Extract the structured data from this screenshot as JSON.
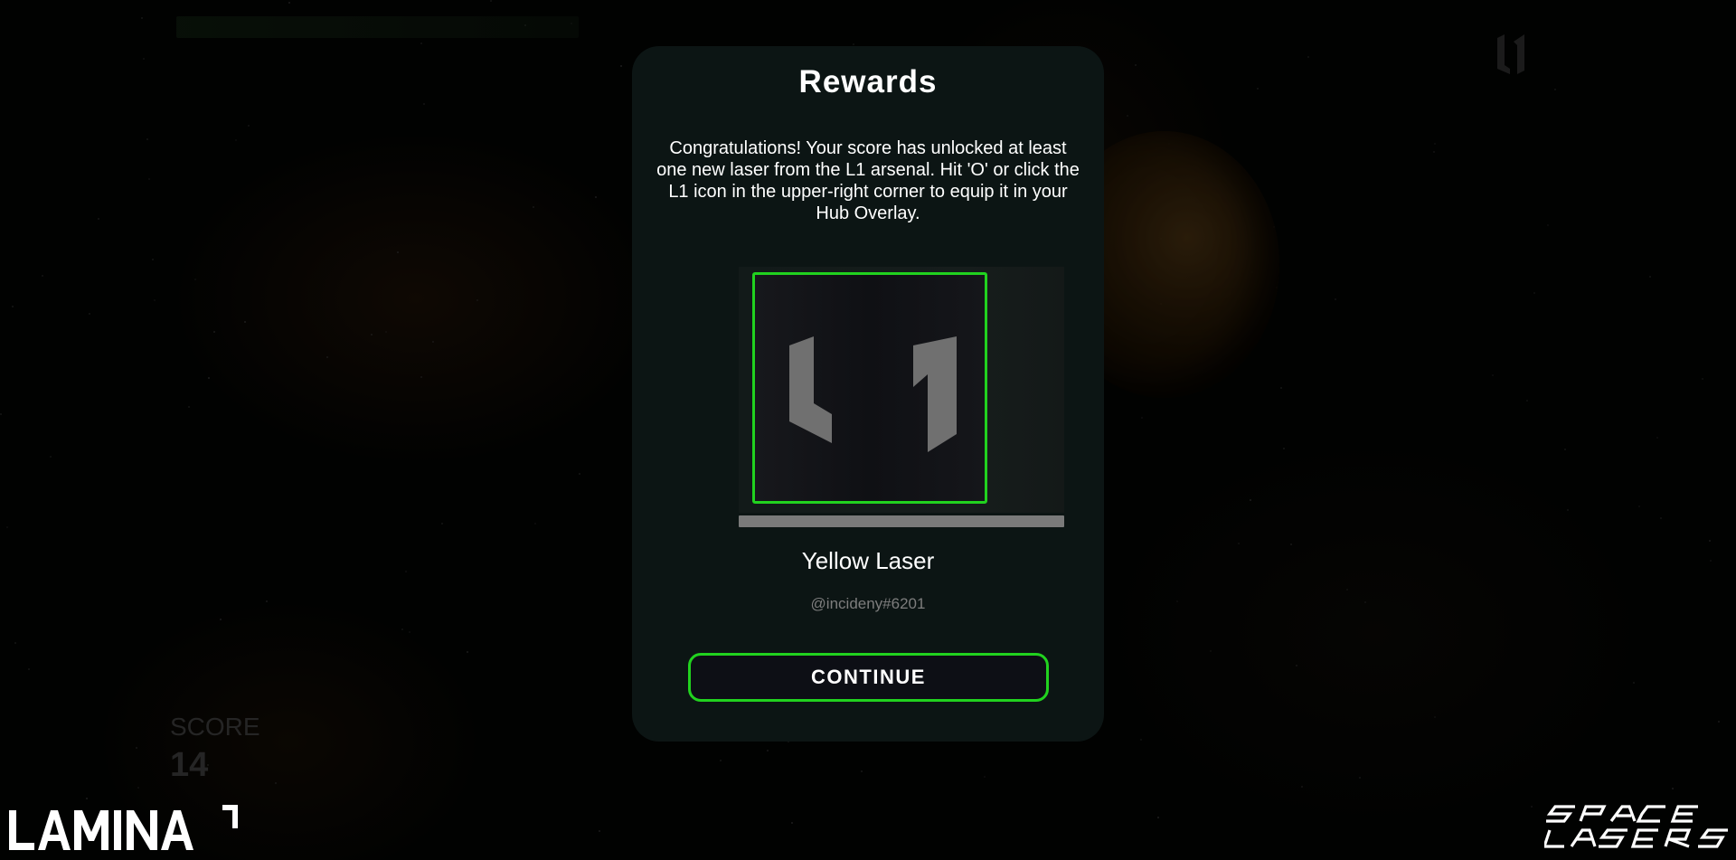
{
  "background": {
    "score_label": "SCORE",
    "score_value": "14",
    "lamina_logo_text": "LAMINA1",
    "space_lasers_logo_text": "SPACE LASERS"
  },
  "modal": {
    "title": "Rewards",
    "message": "Congratulations! Your score has unlocked at least one new laser from the L1 arsenal. Hit 'O' or click the L1 icon in the upper-right corner to equip it in your Hub Overlay.",
    "reward": {
      "icon": "l1-logo-icon",
      "name": "Yellow Laser",
      "author": "@incideny#6201"
    },
    "continue_label": "CONTINUE"
  },
  "colors": {
    "accent_green": "#21d21f",
    "modal_bg": "#0c1514",
    "page_bg": "#030403"
  }
}
